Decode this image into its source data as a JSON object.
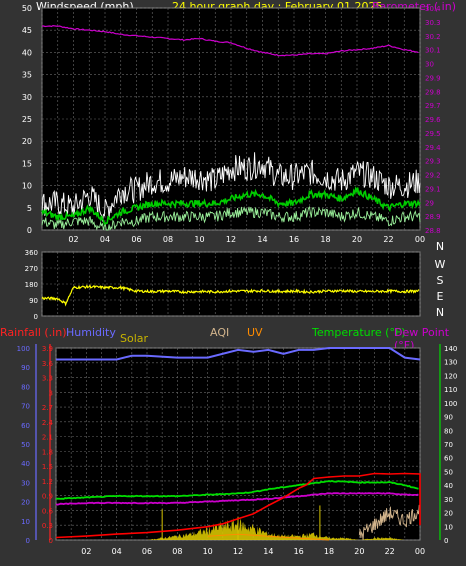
{
  "header": {
    "wind_label": "Windspeed (mph)",
    "graph_title": "24 hour graph day : February 01 2025",
    "baro_label": "Barometer ( in)"
  },
  "dir_letters": [
    "N",
    "W",
    "S",
    "E",
    "N"
  ],
  "bottom_header": {
    "rain": "Rainfall (.in)",
    "humidity": "Humidity",
    "solar": "Solar",
    "aqi": "AQI",
    "uv": "UV",
    "temperature": "Temperature (°F)",
    "dewpoint": "Dew Point (°F)"
  },
  "colors": {
    "background": "#333333",
    "plot_bg": "#000000",
    "grid": "#6a6a6a",
    "axis_text": "#ffffff",
    "title": "#ffff00",
    "barometer": "#cc00cc",
    "wind_gust": "#ffffff",
    "wind_avg": "#00cc00",
    "wind_dir": "#ffff00",
    "rain": "#ff0000",
    "humidity": "#6a6aff",
    "solar": "#c8b400",
    "aqi": "#d2b48c",
    "uv": "#ff8c00",
    "temperature": "#00dd00",
    "dewpoint": "#cc00cc",
    "rain_axis": "#ff2222"
  },
  "chart_data": [
    {
      "type": "line",
      "name": "wind-baro",
      "x_ticks": [
        "02",
        "04",
        "06",
        "08",
        "10",
        "12",
        "14",
        "16",
        "18",
        "20",
        "22",
        "00"
      ],
      "x_range_hours": [
        0,
        24
      ],
      "left_axis": {
        "ticks": [
          0,
          5,
          10,
          15,
          20,
          25,
          30,
          35,
          40,
          45,
          50
        ],
        "ylim": [
          0,
          50
        ]
      },
      "right_axis": {
        "ticks": [
          "28.8",
          "28.9",
          "29",
          "29.1",
          "29.2",
          "29.3",
          "29.4",
          "29.5",
          "29.6",
          "29.7",
          "29.8",
          "29.9",
          "30",
          "30.1",
          "30.2",
          "30.3",
          "30.4"
        ],
        "ylim": [
          28.8,
          30.4
        ]
      },
      "series": [
        {
          "key": "barometer",
          "axis": "right",
          "x": [
            0,
            1,
            2,
            3,
            4,
            5,
            6,
            7,
            8,
            9,
            10,
            11,
            12,
            13,
            14,
            15,
            16,
            17,
            18,
            19,
            20,
            21,
            22,
            23,
            24
          ],
          "values": [
            30.27,
            30.27,
            30.25,
            30.24,
            30.23,
            30.21,
            30.2,
            30.19,
            30.18,
            30.17,
            30.18,
            30.16,
            30.15,
            30.11,
            30.08,
            30.06,
            30.06,
            30.07,
            30.07,
            30.09,
            30.1,
            30.11,
            30.13,
            30.1,
            30.08
          ]
        },
        {
          "key": "gust",
          "axis": "left",
          "x": [
            0,
            1,
            2,
            3,
            4,
            5,
            6,
            7,
            8,
            9,
            10,
            11,
            12,
            13,
            14,
            15,
            16,
            17,
            18,
            19,
            20,
            21,
            22,
            23,
            24
          ],
          "values": [
            6,
            6,
            5,
            8,
            4,
            9,
            9,
            11,
            11,
            12,
            12,
            11,
            14,
            14,
            15,
            12,
            12,
            13,
            12,
            11,
            13,
            12,
            10,
            10,
            11
          ]
        },
        {
          "key": "average",
          "axis": "left",
          "x": [
            0,
            1,
            2,
            3,
            4,
            5,
            6,
            7,
            8,
            9,
            10,
            11,
            12,
            13,
            14,
            15,
            16,
            17,
            18,
            19,
            20,
            21,
            22,
            23,
            24
          ],
          "values": [
            4,
            3,
            3,
            5,
            2,
            4,
            5,
            6,
            6,
            6,
            6,
            6,
            7,
            8,
            8,
            6,
            6,
            8,
            8,
            7,
            9,
            7,
            5,
            6,
            6
          ]
        },
        {
          "key": "wind_min",
          "axis": "left",
          "x": [
            0,
            1,
            2,
            3,
            4,
            5,
            6,
            7,
            8,
            9,
            10,
            11,
            12,
            13,
            14,
            15,
            16,
            17,
            18,
            19,
            20,
            21,
            22,
            23,
            24
          ],
          "values": [
            2,
            1,
            2,
            2,
            0,
            2,
            2,
            3,
            3,
            3,
            3,
            3,
            4,
            4,
            4,
            3,
            3,
            4,
            4,
            3,
            4,
            3,
            2,
            3,
            3
          ]
        }
      ]
    },
    {
      "type": "line",
      "name": "wind-direction",
      "y_ticks": [
        0,
        90,
        180,
        270,
        360
      ],
      "ylim": [
        0,
        360
      ],
      "series": [
        {
          "key": "direction",
          "x": [
            0,
            1,
            1.5,
            2,
            3,
            4,
            5,
            6,
            7,
            8,
            9,
            10,
            11,
            12,
            13,
            14,
            15,
            16,
            17,
            18,
            19,
            20,
            21,
            22,
            23,
            24
          ],
          "values": [
            100,
            98,
            70,
            160,
            165,
            160,
            160,
            140,
            138,
            140,
            135,
            138,
            136,
            140,
            140,
            142,
            138,
            140,
            135,
            140,
            142,
            138,
            138,
            140,
            138,
            140
          ]
        }
      ]
    },
    {
      "type": "line",
      "name": "rain-temp",
      "left_axis_outer": {
        "ticks": [
          0,
          10,
          20,
          30,
          40,
          50,
          60,
          70,
          80,
          90,
          100
        ],
        "ylim": [
          0,
          100
        ]
      },
      "left_axis_inner": {
        "ticks": [
          "0",
          "0.3",
          "0.6",
          "0.9",
          "1.2",
          "1.5",
          "1.8",
          "2.1",
          "2.4",
          "2.7",
          "3",
          "3.3",
          "3.6",
          "3.9"
        ],
        "ylim": [
          0,
          3.9
        ]
      },
      "right_axis": {
        "ticks": [
          0,
          10,
          20,
          30,
          40,
          50,
          60,
          70,
          80,
          90,
          100,
          110,
          120,
          130,
          140
        ],
        "ylim": [
          0,
          140
        ]
      },
      "series": [
        {
          "key": "humidity",
          "axis": "outer",
          "x": [
            0,
            4,
            5,
            6,
            8,
            10,
            12,
            13,
            14,
            15,
            16,
            17,
            18,
            20,
            22,
            23,
            24
          ],
          "values": [
            94,
            94,
            96,
            96,
            95,
            95,
            99,
            98,
            99,
            97,
            99,
            99,
            100,
            100,
            100,
            95,
            94
          ]
        },
        {
          "key": "rain",
          "axis": "inner",
          "x": [
            0,
            2,
            4,
            6,
            8,
            10,
            11,
            12,
            13,
            14,
            15,
            16,
            16.5,
            17,
            18,
            19,
            20,
            21,
            22,
            23,
            24,
            24
          ],
          "values": [
            0.05,
            0.08,
            0.12,
            0.15,
            0.2,
            0.27,
            0.33,
            0.43,
            0.53,
            0.7,
            0.86,
            1.05,
            1.12,
            1.25,
            1.28,
            1.3,
            1.3,
            1.35,
            1.34,
            1.35,
            1.34,
            0.3
          ]
        },
        {
          "key": "temperature",
          "axis": "right",
          "x": [
            0,
            2,
            4,
            6,
            8,
            10,
            12,
            13,
            14,
            16,
            18,
            20,
            22,
            23,
            24
          ],
          "values": [
            30,
            31,
            32,
            32,
            32,
            33,
            34,
            35,
            37,
            40,
            43,
            42,
            42,
            40,
            37
          ]
        },
        {
          "key": "dewpoint",
          "axis": "right",
          "x": [
            0,
            2,
            4,
            6,
            8,
            10,
            12,
            14,
            16,
            18,
            20,
            22,
            23,
            24
          ],
          "values": [
            26,
            27,
            27,
            27,
            27,
            28,
            29,
            30,
            32,
            34,
            34,
            34,
            33,
            33
          ]
        },
        {
          "key": "uv",
          "axis": "outer",
          "x": [
            10,
            12,
            14,
            16,
            18
          ],
          "values": [
            2,
            3,
            2,
            1,
            0
          ]
        },
        {
          "key": "aqi",
          "axis": "outer",
          "x": [
            20,
            21,
            22,
            23,
            24
          ],
          "values": [
            2,
            8,
            14,
            10,
            16
          ]
        }
      ],
      "solar": {
        "x": [
          6,
          7,
          8,
          9,
          10,
          11,
          12,
          13,
          14,
          15,
          16,
          17,
          18,
          19,
          20,
          21,
          22,
          23,
          24
        ],
        "values": [
          0,
          1,
          2,
          3,
          5,
          7,
          8,
          6,
          3,
          2,
          2,
          3,
          1,
          1,
          0,
          1,
          1,
          0,
          0
        ]
      }
    }
  ]
}
